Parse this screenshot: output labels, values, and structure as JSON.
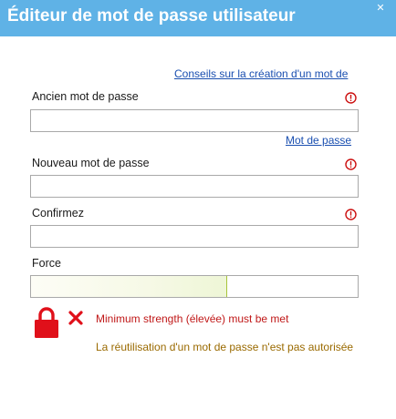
{
  "window": {
    "title": "Éditeur de mot de passe utilisateur",
    "close_glyph": "✕",
    "title_bar_color": "#5fb2e6"
  },
  "links": {
    "tips": "Conseils sur la création d'un mot de",
    "generate": "Mot de passe"
  },
  "fields": {
    "old_password": {
      "label": "Ancien mot de passe",
      "value": "",
      "required_icon": "alert-circle-icon"
    },
    "new_password": {
      "label": "Nouveau mot de passe",
      "value": "",
      "required_icon": "alert-circle-icon"
    },
    "confirm": {
      "label": "Confirmez",
      "value": "",
      "required_icon": "alert-circle-icon"
    }
  },
  "strength": {
    "label": "Force",
    "level": 0.6
  },
  "validation": {
    "lock_icon": "lock-icon",
    "error_icon": "x-icon",
    "error_message": "Minimum strength (élevée) must be met",
    "warning_message": "La réutilisation d'un mot de passe n'est pas autorisée",
    "error_color": "#c01818",
    "warning_color": "#9a6a00"
  }
}
